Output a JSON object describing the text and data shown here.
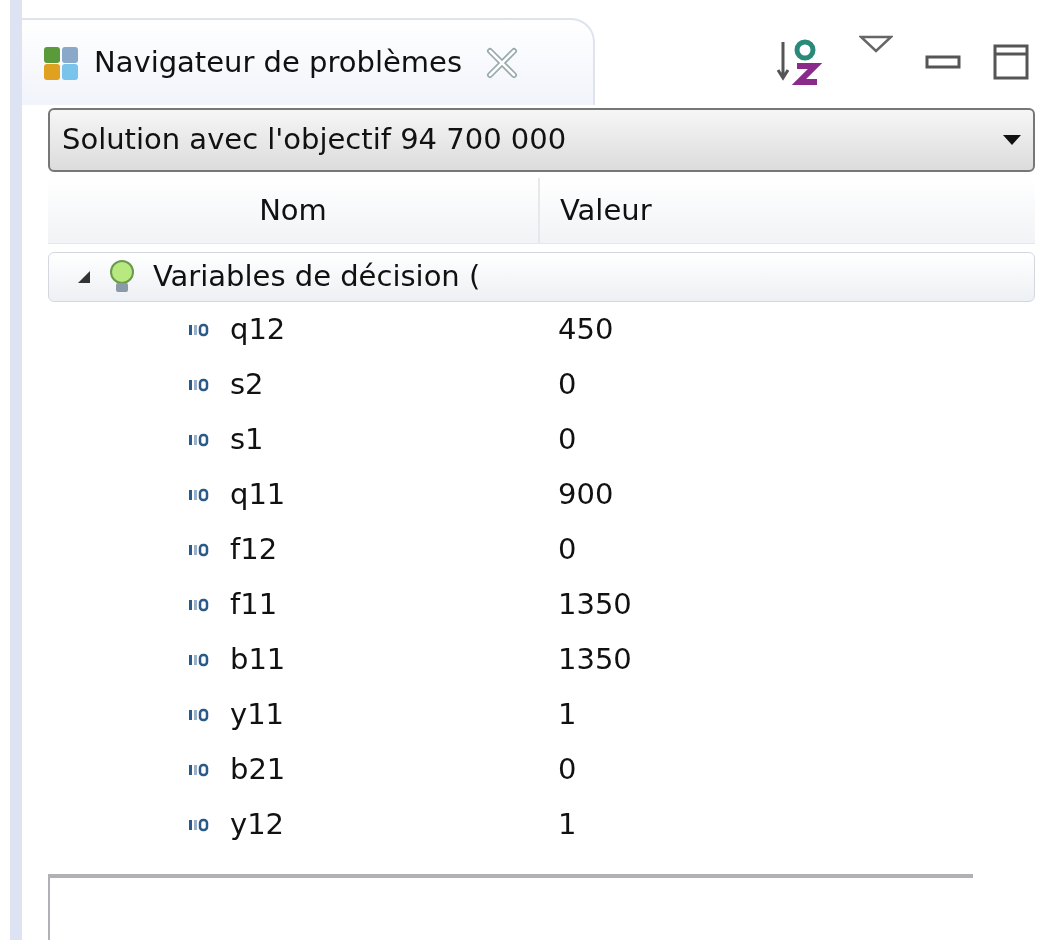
{
  "view": {
    "title": "Navigateur de problèmes"
  },
  "solution_select": {
    "value": "Solution avec l'objectif 94 700 000"
  },
  "table": {
    "columns": [
      "Nom",
      "Valeur"
    ],
    "rows": [
      {
        "label": "Variables de décision (",
        "expanded": true,
        "children": [
          {
            "name": "q12",
            "value": "450"
          },
          {
            "name": "s2",
            "value": "0"
          },
          {
            "name": "s1",
            "value": "0"
          },
          {
            "name": "q11",
            "value": "900"
          },
          {
            "name": "f12",
            "value": "0"
          },
          {
            "name": "f11",
            "value": "1350"
          },
          {
            "name": "b11",
            "value": "1350"
          },
          {
            "name": "y11",
            "value": "1"
          },
          {
            "name": "b21",
            "value": "0"
          },
          {
            "name": "y12",
            "value": "1"
          }
        ]
      }
    ]
  }
}
